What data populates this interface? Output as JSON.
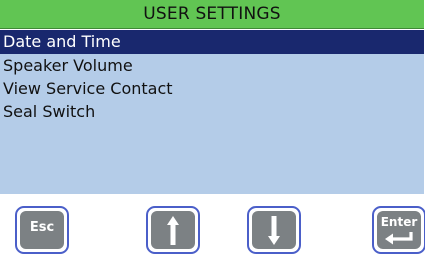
{
  "header": {
    "title": "USER SETTINGS"
  },
  "menu": {
    "items": [
      {
        "label": "Date and Time",
        "selected": true
      },
      {
        "label": "Speaker Volume",
        "selected": false
      },
      {
        "label": "View Service Contact",
        "selected": false
      },
      {
        "label": "Seal Switch",
        "selected": false
      }
    ]
  },
  "softkeys": {
    "esc_label": "Esc",
    "up_icon": "arrow-up-icon",
    "down_icon": "arrow-down-icon",
    "enter_label": "Enter",
    "enter_icon": "return-arrow-icon"
  },
  "colors": {
    "title_bar": "#61c553",
    "menu_background": "#b4cce8",
    "selection": "#19286e",
    "key_border": "#4b5fc9",
    "key_fill": "#7c8184"
  }
}
